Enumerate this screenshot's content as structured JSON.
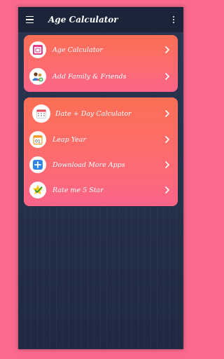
{
  "app": {
    "title": "Age Calculator"
  },
  "card1": {
    "items": [
      {
        "label": "Age Calculator",
        "icon": "calendar-icon"
      },
      {
        "label": "Add Family & Friends",
        "icon": "family-icon"
      }
    ]
  },
  "card2": {
    "items": [
      {
        "label": "Date + Day Calculator",
        "icon": "calendar-grid-icon"
      },
      {
        "label": "Leap Year",
        "icon": "calendar-01-icon"
      },
      {
        "label": "Download More Apps",
        "icon": "plus-icon"
      },
      {
        "label": "Rate me 5 Star",
        "icon": "star-check-icon"
      }
    ]
  },
  "colors": {
    "background": "#fb6a8e",
    "appbar": "#1b2438",
    "card_top": "#fd6f55",
    "card_bottom": "#fc6589"
  }
}
